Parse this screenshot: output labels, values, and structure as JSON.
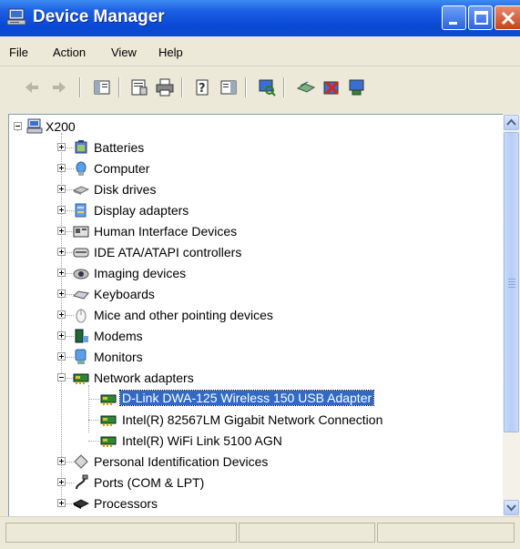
{
  "window": {
    "title": "Device Manager"
  },
  "menu": [
    "File",
    "Action",
    "View",
    "Help"
  ],
  "toolbar": [
    "back-icon",
    "forward-icon",
    "show-hide-console-tree-icon",
    "properties-icon",
    "print-icon",
    "help-icon",
    "show-hide-action-pane-icon",
    "scan-hardware-icon",
    "update-driver-icon",
    "uninstall-icon",
    "enable-device-icon"
  ],
  "tree": {
    "root": "X200",
    "items": [
      {
        "label": "Batteries",
        "icon": "battery-icon",
        "expanded": false
      },
      {
        "label": "Computer",
        "icon": "computer-icon",
        "expanded": false
      },
      {
        "label": "Disk drives",
        "icon": "disk-drive-icon",
        "expanded": false
      },
      {
        "label": "Display adapters",
        "icon": "display-adapter-icon",
        "expanded": false
      },
      {
        "label": "Human Interface Devices",
        "icon": "hid-icon",
        "expanded": false
      },
      {
        "label": "IDE ATA/ATAPI controllers",
        "icon": "ide-controller-icon",
        "expanded": false
      },
      {
        "label": "Imaging devices",
        "icon": "camera-icon",
        "expanded": false
      },
      {
        "label": "Keyboards",
        "icon": "keyboard-icon",
        "expanded": false
      },
      {
        "label": "Mice and other pointing devices",
        "icon": "mouse-icon",
        "expanded": false
      },
      {
        "label": "Modems",
        "icon": "modem-icon",
        "expanded": false
      },
      {
        "label": "Monitors",
        "icon": "monitor-icon",
        "expanded": false
      },
      {
        "label": "Network adapters",
        "icon": "network-adapter-icon",
        "expanded": true,
        "children": [
          {
            "label": "D-Link DWA-125 Wireless 150 USB Adapter",
            "icon": "network-card-icon",
            "selected": true
          },
          {
            "label": "Intel(R) 82567LM Gigabit Network Connection",
            "icon": "network-card-icon"
          },
          {
            "label": "Intel(R) WiFi Link 5100 AGN",
            "icon": "network-card-icon"
          }
        ]
      },
      {
        "label": "Personal Identification Devices",
        "icon": "fingerprint-icon",
        "expanded": false
      },
      {
        "label": "Ports (COM & LPT)",
        "icon": "port-icon",
        "expanded": false
      },
      {
        "label": "Processors",
        "icon": "processor-icon",
        "expanded": false
      }
    ]
  },
  "colors": {
    "titlebar": "#0a49d6",
    "selection": "#316ac5",
    "chrome": "#ece9d8"
  }
}
